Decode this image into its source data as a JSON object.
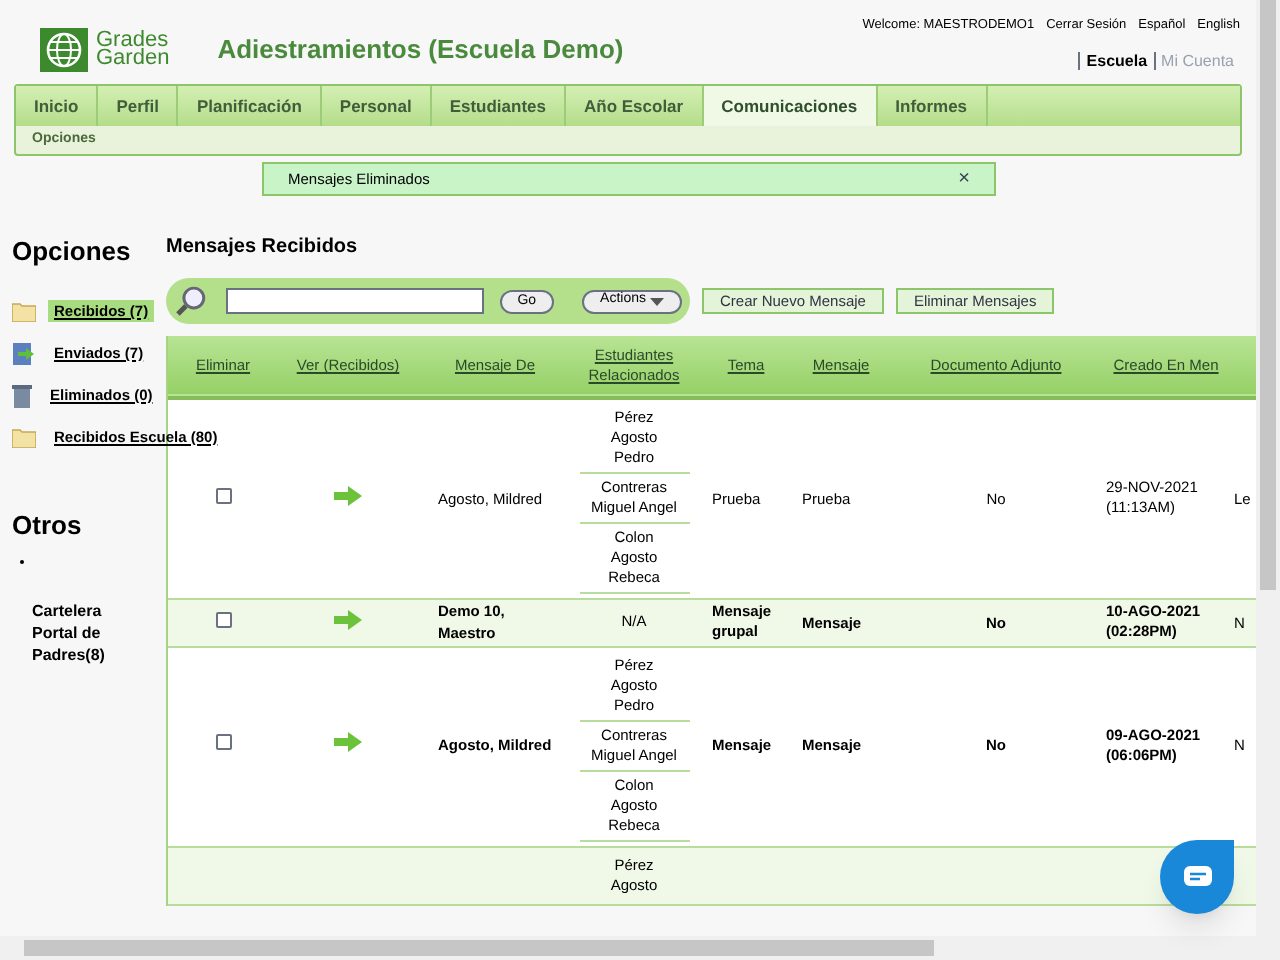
{
  "logo": {
    "line1": "Grades",
    "line2": "Garden"
  },
  "page_title": "Adiestramientos (Escuela Demo)",
  "user_links": [
    "Welcome: MAESTRODEMO1",
    "Cerrar Sesión",
    "Español",
    "English"
  ],
  "account_tabs": [
    {
      "label": "Escuela",
      "selected": true
    },
    {
      "label": "Mi Cuenta",
      "selected": false
    }
  ],
  "tabs": [
    {
      "label": "Inicio",
      "selected": false
    },
    {
      "label": "Perfil",
      "selected": false
    },
    {
      "label": "Planificación",
      "selected": false
    },
    {
      "label": "Personal",
      "selected": false
    },
    {
      "label": "Estudiantes",
      "selected": false
    },
    {
      "label": "Año Escolar",
      "selected": false
    },
    {
      "label": "Comunicaciones",
      "selected": true
    },
    {
      "label": "Informes",
      "selected": false
    }
  ],
  "subnav": [
    "Opciones"
  ],
  "notice": {
    "text": "Mensajes Eliminados",
    "close": "×"
  },
  "sidebar": {
    "title": "Opciones",
    "items": [
      {
        "label": "Recibidos (7)",
        "kind": "folder",
        "selected": true
      },
      {
        "label": "Enviados (7)",
        "kind": "sent",
        "selected": false
      },
      {
        "label": "Eliminados (0)",
        "kind": "trash",
        "selected": false
      },
      {
        "label": "Recibidos Escuela (80)",
        "kind": "folder",
        "selected": false
      }
    ],
    "others_title": "Otros",
    "others": [
      "Cartelera Portal de Padres(8)"
    ]
  },
  "main": {
    "title": "Mensajes Recibidos",
    "search": {
      "go": "Go",
      "actions": "Actions"
    },
    "buttons": [
      "Crear Nuevo Mensaje",
      "Eliminar Mensajes"
    ]
  },
  "table": {
    "columns": [
      "Eliminar",
      "Ver (Recibidos)",
      "Mensaje De",
      "Estudiantes Relacionados",
      "Tema",
      "Mensaje",
      "Documento Adjunto",
      "Creado En Men"
    ],
    "rows": [
      {
        "checked": false,
        "unread": false,
        "from": "Agosto, Mildred",
        "students": [
          "Pérez Agosto Pedro",
          "Contreras Miguel Angel",
          "Colon Agosto Rebeca"
        ],
        "subject": "Prueba",
        "message": "Prueba",
        "attachment": "No",
        "created": "29-NOV-2021 (11:13AM)",
        "column_9": "Le"
      },
      {
        "checked": false,
        "unread": true,
        "from": "Demo 10, Maestro",
        "students": [
          "N/A"
        ],
        "subject": "Mensaje grupal",
        "message": "Mensaje",
        "attachment": "No",
        "created": "10-AGO-2021 (02:28PM)",
        "column_9": "N"
      },
      {
        "checked": false,
        "unread": true,
        "from": "Agosto, Mildred",
        "students": [
          "Pérez Agosto Pedro",
          "Contreras Miguel Angel",
          "Colon Agosto Rebeca"
        ],
        "subject": "Mensaje",
        "message": "Mensaje",
        "attachment": "No",
        "created": "09-AGO-2021 (06:06PM)",
        "column_9": "N"
      },
      {
        "students": [
          "Pérez Agosto"
        ]
      }
    ]
  }
}
